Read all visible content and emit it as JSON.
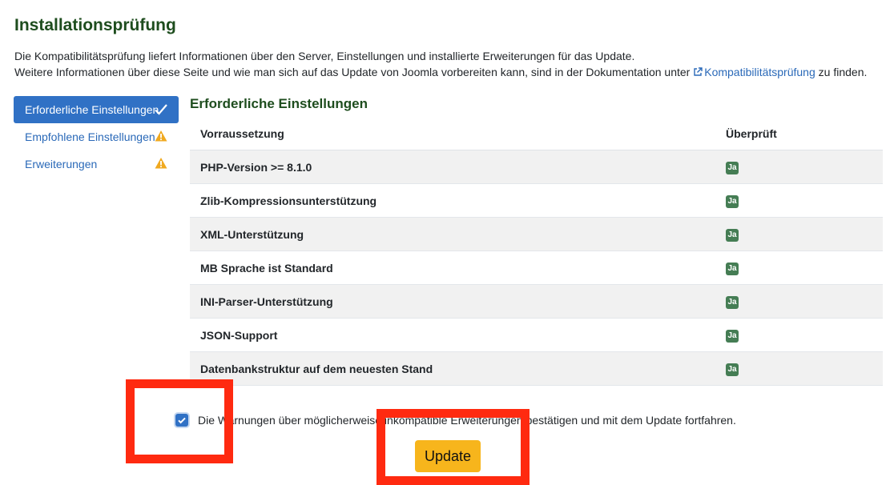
{
  "page": {
    "title": "Installationsprüfung",
    "intro_line1": "Die Kompatibilitätsprüfung liefert Informationen über den Server, Einstellungen und installierte Erweiterungen für das Update.",
    "intro_line2_prefix": "Weitere Informationen über diese Seite und wie man sich auf das Update von Joomla vorbereiten kann, sind in der Dokumentation unter",
    "intro_link": "Kompatibilitätsprüfung",
    "intro_line2_suffix": "zu finden."
  },
  "sidebar": {
    "items": [
      {
        "label": "Erforderliche Einstellungen",
        "status": "check-icon",
        "active": true
      },
      {
        "label": "Empfohlene Einstellungen",
        "status": "warning-icon",
        "active": false
      },
      {
        "label": "Erweiterungen",
        "status": "warning-icon",
        "active": false
      }
    ]
  },
  "section": {
    "title": "Erforderliche Einstellungen",
    "columns": [
      "Vorraussetzung",
      "Überprüft"
    ],
    "rows": [
      {
        "requirement": "PHP-Version >= 8.1.0",
        "checked": "Ja"
      },
      {
        "requirement": "Zlib-Kompressionsunterstützung",
        "checked": "Ja"
      },
      {
        "requirement": "XML-Unterstützung",
        "checked": "Ja"
      },
      {
        "requirement": "MB Sprache ist Standard",
        "checked": "Ja"
      },
      {
        "requirement": "INI-Parser-Unterstützung",
        "checked": "Ja"
      },
      {
        "requirement": "JSON-Support",
        "checked": "Ja"
      },
      {
        "requirement": "Datenbankstruktur auf dem neuesten Stand",
        "checked": "Ja"
      }
    ]
  },
  "confirm": {
    "checked": true,
    "label": "Die Warnungen über möglicherweise inkompatible Erweiterungen bestätigen und mit dem Update fortfahren."
  },
  "update_button": {
    "label": "Update"
  },
  "colors": {
    "primary": "#3071c5",
    "success": "#457d54",
    "warning": "#f7b51c",
    "highlight": "#ff2a10",
    "heading": "#1e4d1e"
  }
}
